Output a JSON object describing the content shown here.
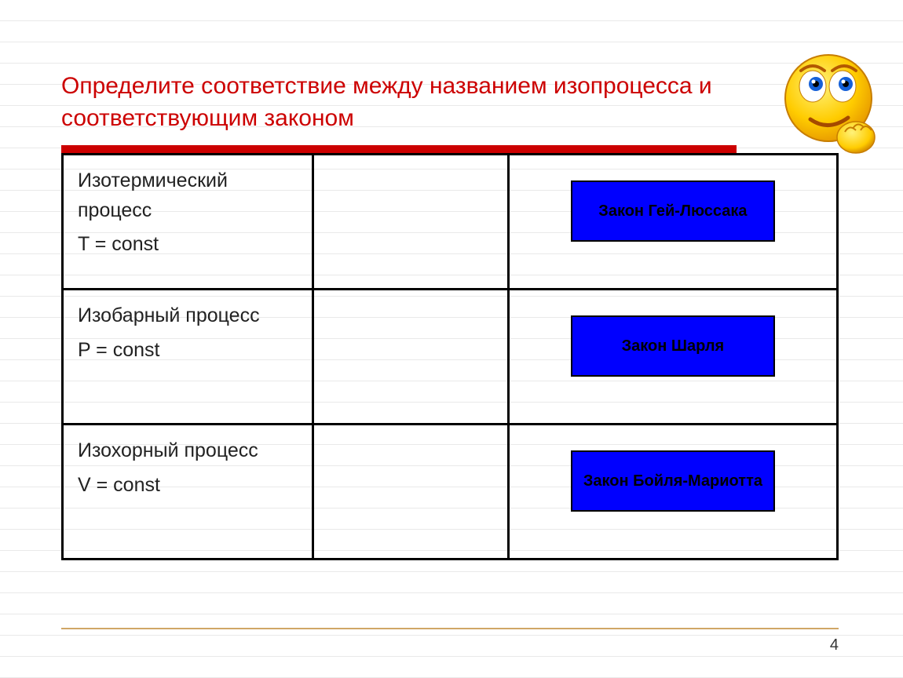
{
  "title": "Определите соответствие между названием изопроцесса и соответствующим законом",
  "rows": [
    {
      "process_name": "Изотермический процесс",
      "formula": "T = const",
      "law": "Закон Гей-Люссака"
    },
    {
      "process_name": "Изобарный процесс",
      "formula": "P = const",
      "law": "Закон Шарля"
    },
    {
      "process_name": "Изохорный процесс",
      "formula": "V = const",
      "law": "Закон Бойля-Мариотта"
    }
  ],
  "page_number": "4"
}
